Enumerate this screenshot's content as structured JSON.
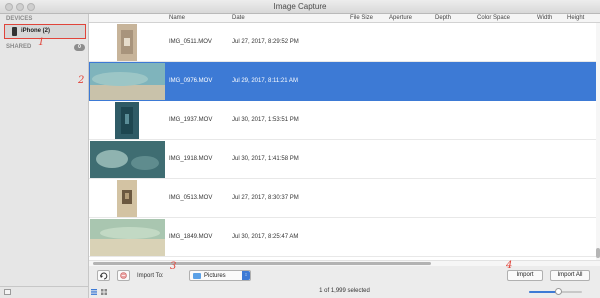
{
  "window": {
    "title": "Image Capture"
  },
  "sidebar": {
    "devices_header": "DEVICES",
    "device_label": "iPhone (2)",
    "shared_header": "SHARED",
    "shared_count": "0"
  },
  "annotations": [
    "1",
    "2",
    "3",
    "4"
  ],
  "columns": {
    "name": "Name",
    "date": "Date",
    "file_size": "File Size",
    "aperture": "Aperture",
    "depth": "Depth",
    "color_space": "Color Space",
    "width": "Width",
    "height": "Height"
  },
  "files": [
    {
      "name": "IMG_0511.MOV",
      "date": "Jul 27, 2017, 8:29:52 PM",
      "selected": false
    },
    {
      "name": "IMG_0976.MOV",
      "date": "Jul 29, 2017, 8:11:21 AM",
      "selected": true
    },
    {
      "name": "IMG_1937.MOV",
      "date": "Jul 30, 2017, 1:53:51 PM",
      "selected": false
    },
    {
      "name": "IMG_1918.MOV",
      "date": "Jul 30, 2017, 1:41:58 PM",
      "selected": false
    },
    {
      "name": "IMG_0513.MOV",
      "date": "Jul 27, 2017, 8:30:37 PM",
      "selected": false
    },
    {
      "name": "IMG_1849.MOV",
      "date": "Jul 30, 2017, 8:25:47 AM",
      "selected": false
    }
  ],
  "toolbar": {
    "import_to_label": "Import To:",
    "destination": "Pictures",
    "import_button": "Import",
    "import_all_button": "Import All"
  },
  "status": {
    "text": "1 of 1,999 selected",
    "zoom_level": 0.55
  },
  "colors": {
    "accent": "#3d7ad5",
    "annotation": "#e0443a"
  },
  "icons": [
    "iphone-icon",
    "rotate-icon",
    "delete-icon",
    "folder-icon",
    "list-view-icon",
    "grid-view-icon",
    "add-icon"
  ]
}
